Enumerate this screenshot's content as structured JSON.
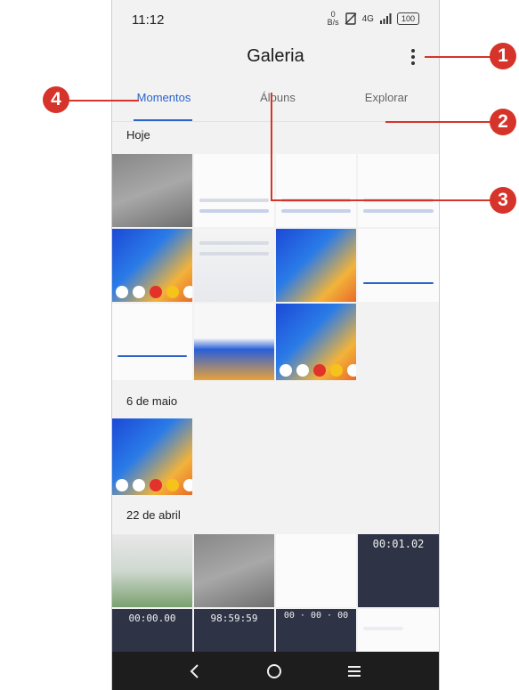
{
  "status": {
    "time": "11:12",
    "net_speed_top": "0",
    "net_speed_unit": "B/s",
    "network": "4G",
    "battery": "100"
  },
  "app": {
    "title": "Galeria",
    "more_label": "Mais opções"
  },
  "tabs": [
    {
      "label": "Momentos"
    },
    {
      "label": "Álbuns"
    },
    {
      "label": "Explorar"
    }
  ],
  "sections": [
    {
      "label": "Hoje"
    },
    {
      "label": "6 de maio"
    },
    {
      "label": "22 de abril"
    }
  ],
  "thumb_text": {
    "timer_a": "00:01.02",
    "timer_b": "00:00.00",
    "timer_c": "98:59:59",
    "timer_d": "00 · 00 · 00"
  },
  "callouts": [
    "1",
    "2",
    "3",
    "4"
  ],
  "colors": {
    "accent": "#2b63c9",
    "callout": "#d6342a",
    "navbar": "#1d1d1d"
  },
  "icons": {
    "back": "back-icon",
    "home": "home-icon",
    "recents": "recents-icon",
    "more": "more-vertical-icon"
  }
}
